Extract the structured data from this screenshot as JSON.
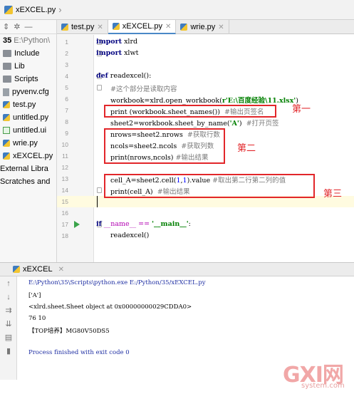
{
  "breadcrumb": {
    "file": "xEXCEL.py"
  },
  "project": {
    "root_label": "35",
    "root_path": "E:\\Python\\",
    "items": [
      {
        "label": "Include",
        "icon": "folder-icon"
      },
      {
        "label": "Lib",
        "icon": "folder-icon"
      },
      {
        "label": "Scripts",
        "icon": "folder-icon"
      },
      {
        "label": "pyvenv.cfg",
        "icon": "config-file-icon"
      },
      {
        "label": "test.py",
        "icon": "python-file-icon"
      },
      {
        "label": "untitled.py",
        "icon": "python-file-icon"
      },
      {
        "label": "untitled.ui",
        "icon": "ui-file-icon"
      },
      {
        "label": "wrie.py",
        "icon": "python-file-icon"
      },
      {
        "label": "xEXCEL.py",
        "icon": "python-file-icon"
      }
    ],
    "external": "External Libra",
    "scratches": "Scratches and"
  },
  "tabs": [
    {
      "label": "test.py",
      "active": false
    },
    {
      "label": "xEXCEL.py",
      "active": true
    },
    {
      "label": "wrie.py",
      "active": false
    }
  ],
  "code": {
    "l1_kw": "import",
    "l1_rest": " xlrd",
    "l2_kw": "import",
    "l2_rest": " xlwt",
    "l4_kw": "def",
    "l4_rest": " readexcel():",
    "l5": "#这个部分是读取内容",
    "l6_a": "workbook=xlrd.open_workbook(",
    "l6_str": "r'E:\\百度经验\\11.xlsx'",
    "l6_b": ")",
    "l7_a": "print (workbook.sheet_names())  ",
    "l7_cm": "#输出页签名",
    "l8_a": "sheet2=workbook.sheet_by_name(",
    "l8_str": "'A'",
    "l8_b": ")  ",
    "l8_cm": "#打开页签",
    "l9_a": "nrows=sheet2.nrows  ",
    "l9_cm": "#获取行数",
    "l10_a": "ncols=sheet2.ncols  ",
    "l10_cm": "#获取列数",
    "l11_a": "print(nrows,ncols) ",
    "l11_cm": "#输出结果",
    "l13_a": "cell_A=sheet2.cell(",
    "l13_n1": "1",
    "l13_c": ",",
    "l13_n2": "1",
    "l13_b": ").value ",
    "l13_cm": "#取出第二行第二列的值",
    "l14_a": "print(cell_A)  ",
    "l14_cm": "#输出结果",
    "l17_kw": "if",
    "l17_a": " __name__ == ",
    "l17_str": "'__main__'",
    "l17_b": ":",
    "l18": "readexcel()"
  },
  "annotations": {
    "first": "第一",
    "second": "第二",
    "third": "第三"
  },
  "run": {
    "tab": "xEXCEL",
    "lines": [
      "E:\\Python\\35\\Scripts\\python.exe E:/Python/35/xEXCEL.py",
      "['A']",
      "<xlrd.sheet.Sheet object at 0x00000000029CDDA0>",
      "76 10",
      "【TOP培养】MG80V50DS5",
      "",
      "Process finished with exit code 0"
    ]
  },
  "watermark": {
    "big": "GXI网",
    "small": "system.com"
  },
  "colors": {
    "annotation_red": "#e2262a",
    "keyword": "#000080",
    "string": "#008000",
    "comment": "#7a7a7a"
  }
}
